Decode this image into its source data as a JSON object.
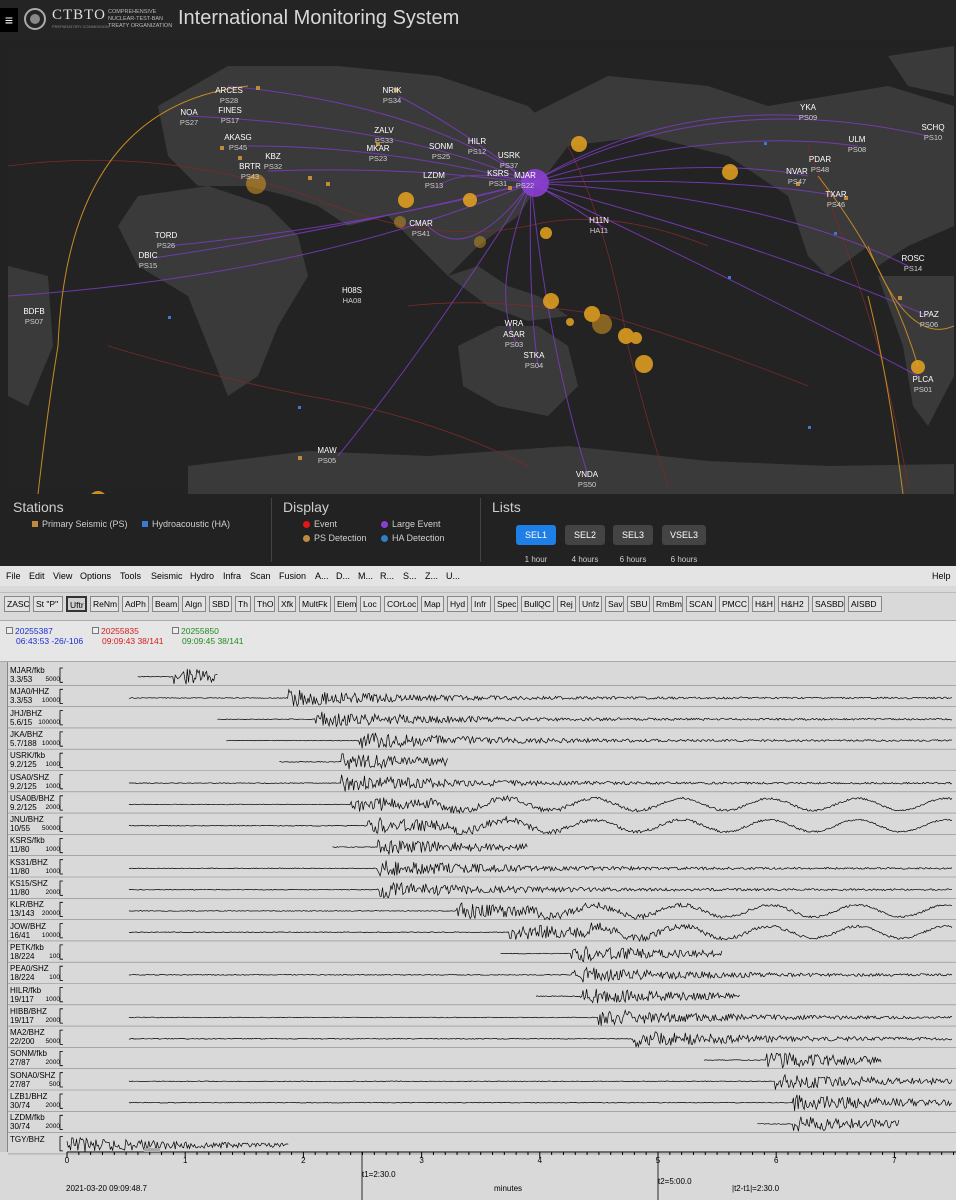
{
  "header": {
    "menu_icon": "hamburger-icon",
    "logo_name": "CTBTO",
    "logo_sub": "PREPARATORY COMMISSION",
    "logo_org": "COMPREHENSIVE NUCLEAR-TEST-BAN TREATY ORGANIZATION",
    "title": "International Monitoring System"
  },
  "map": {
    "stations": [
      {
        "name": "ARCES",
        "code": "PS28"
      },
      {
        "name": "NOA",
        "code": "PS27"
      },
      {
        "name": "FINES",
        "code": "PS17"
      },
      {
        "name": "NRIK",
        "code": "PS34"
      },
      {
        "name": "YKA",
        "code": "PS09"
      },
      {
        "name": "SCHQ",
        "code": "PS10"
      },
      {
        "name": "ULM",
        "code": "PS08"
      },
      {
        "name": "AKASG",
        "code": "PS45"
      },
      {
        "name": "ZALV",
        "code": "PS33"
      },
      {
        "name": "MKAR",
        "code": "PS23"
      },
      {
        "name": "SONM",
        "code": "PS25"
      },
      {
        "name": "HILR",
        "code": "PS12"
      },
      {
        "name": "KBZ",
        "code": "PS32"
      },
      {
        "name": "BRTR",
        "code": "PS43"
      },
      {
        "name": "USRK",
        "code": "PS37"
      },
      {
        "name": "KSRS",
        "code": "PS31"
      },
      {
        "name": "MJAR",
        "code": "PS22"
      },
      {
        "name": "PDAR",
        "code": "PS48"
      },
      {
        "name": "NVAR",
        "code": "PS47"
      },
      {
        "name": "LZDM",
        "code": "PS13"
      },
      {
        "name": "TXAR",
        "code": "PS46"
      },
      {
        "name": "CMAR",
        "code": "PS41"
      },
      {
        "name": "H11N",
        "code": "HA11"
      },
      {
        "name": "TORD",
        "code": "PS26"
      },
      {
        "name": "DBIC",
        "code": "PS15"
      },
      {
        "name": "ROSC",
        "code": "PS14"
      },
      {
        "name": "H08S",
        "code": "HA08"
      },
      {
        "name": "BDFB",
        "code": "PS07"
      },
      {
        "name": "LPAZ",
        "code": "PS06"
      },
      {
        "name": "WRA",
        "code": ""
      },
      {
        "name": "ASAR",
        "code": "PS03"
      },
      {
        "name": "STKA",
        "code": "PS04"
      },
      {
        "name": "PLCA",
        "code": "PS01"
      },
      {
        "name": "MAW",
        "code": "PS05"
      },
      {
        "name": "VNDA",
        "code": "PS50"
      }
    ]
  },
  "legend": {
    "stations_title": "Stations",
    "primary_seismic": "Primary Seismic (PS)",
    "hydroacoustic": "Hydroacoustic (HA)",
    "display_title": "Display",
    "event": "Event",
    "large_event": "Large Event",
    "ps_detection": "PS Detection",
    "ha_detection": "HA Detection",
    "lists_title": "Lists",
    "lists": [
      {
        "label": "SEL1",
        "duration": "1 hour"
      },
      {
        "label": "SEL2",
        "duration": "4 hours"
      },
      {
        "label": "SEL3",
        "duration": "6 hours"
      },
      {
        "label": "VSEL3",
        "duration": "6 hours"
      }
    ],
    "colors": {
      "primary": "#c08a3e",
      "hydro": "#3a7ad0",
      "event": "#e41616",
      "large_event": "#8b3fd1",
      "ps_det": "#c08a3e",
      "ha_det": "#2f7fc1",
      "active": "#1e7fe6"
    }
  },
  "menubar": {
    "items": [
      "File",
      "Edit",
      "View",
      "Options",
      "Tools",
      "Seismic",
      "Hydro",
      "Infra",
      "Scan",
      "Fusion",
      "A...",
      "D...",
      "M...",
      "R...",
      "S...",
      "Z...",
      "U..."
    ],
    "help": "Help"
  },
  "toolbar": {
    "buttons": [
      "ZASC",
      "St \"P\"",
      "Uftr",
      "ReNm",
      "AdPh",
      "Beam",
      "Algn",
      "SBD",
      "Th",
      "ThO",
      "Xfk",
      "MultFk",
      "Elem",
      "Loc",
      "COrLoc",
      "Map",
      "Hyd",
      "Infr",
      "Spec",
      "BullQC",
      "Rej",
      "Unfz",
      "Sav",
      "SBU",
      "RmBm",
      "SCAN",
      "PMCC",
      "H&H",
      "H&H2",
      "SASBD",
      "AISBD"
    ]
  },
  "events": [
    {
      "id": "20255387",
      "info": "06:43:53 -26/-106",
      "color": "#1a2bd6"
    },
    {
      "id": "20255835",
      "info": "09:09:43 38/141",
      "color": "#d61a1a"
    },
    {
      "id": "20255850",
      "info": "09:09:45 38/141",
      "color": "#1f8a1f"
    }
  ],
  "traces": [
    {
      "name": "MJAR/fkb",
      "dist": "3.3/53",
      "amp": "5000",
      "start": 0.08,
      "end": 0.17,
      "onset": 0.12
    },
    {
      "name": "MJA0/HHZ",
      "dist": "3.3/53",
      "amp": "10000",
      "start": 0.07,
      "end": 1.0,
      "onset": 0.25
    },
    {
      "name": "JHJ/BHZ",
      "dist": "5.6/15",
      "amp": "100000",
      "start": 0.17,
      "end": 1.0,
      "onset": 0.28
    },
    {
      "name": "JKA/BHZ",
      "dist": "5.7/188",
      "amp": "10000",
      "start": 0.18,
      "end": 1.0,
      "onset": 0.33
    },
    {
      "name": "USRK/fkb",
      "dist": "9.2/125",
      "amp": "1000",
      "start": 0.24,
      "end": 0.43,
      "onset": 0.31
    },
    {
      "name": "USA0/SHZ",
      "dist": "9.2/125",
      "amp": "1000",
      "start": 0.07,
      "end": 1.0,
      "onset": 0.31
    },
    {
      "name": "USA0B/BHZ",
      "dist": "9.2/125",
      "amp": "2000",
      "start": 0.07,
      "end": 1.0,
      "onset": 0.32
    },
    {
      "name": "JNU/BHZ",
      "dist": "10/55",
      "amp": "50000",
      "start": 0.07,
      "end": 1.0,
      "onset": 0.34
    },
    {
      "name": "KSRS/fkb",
      "dist": "11/80",
      "amp": "1000",
      "start": 0.3,
      "end": 0.52,
      "onset": 0.35
    },
    {
      "name": "KS31/BHZ",
      "dist": "11/80",
      "amp": "1000",
      "start": 0.07,
      "end": 1.0,
      "onset": 0.35
    },
    {
      "name": "KS15/SHZ",
      "dist": "11/80",
      "amp": "2000",
      "start": 0.07,
      "end": 1.0,
      "onset": 0.35
    },
    {
      "name": "KLR/BHZ",
      "dist": "13/143",
      "amp": "20000",
      "start": 0.07,
      "end": 1.0,
      "onset": 0.44
    },
    {
      "name": "JOW/BHZ",
      "dist": "16/41",
      "amp": "10000",
      "start": 0.07,
      "end": 1.0,
      "onset": 0.5
    },
    {
      "name": "PETK/fkb",
      "dist": "18/224",
      "amp": "100",
      "start": 0.49,
      "end": 0.74,
      "onset": 0.57
    },
    {
      "name": "PEA0/SHZ",
      "dist": "18/224",
      "amp": "100",
      "start": 0.07,
      "end": 1.0,
      "onset": 0.57
    },
    {
      "name": "HILR/fkb",
      "dist": "19/117",
      "amp": "1000",
      "start": 0.53,
      "end": 0.76,
      "onset": 0.58
    },
    {
      "name": "HIBB/BHZ",
      "dist": "19/117",
      "amp": "2000",
      "start": 0.07,
      "end": 1.0,
      "onset": 0.6
    },
    {
      "name": "MA2/BHZ",
      "dist": "22/200",
      "amp": "5000",
      "start": 0.07,
      "end": 1.0,
      "onset": 0.64
    },
    {
      "name": "SONM/fkb",
      "dist": "27/87",
      "amp": "2000",
      "start": 0.72,
      "end": 0.92,
      "onset": 0.79
    },
    {
      "name": "SONA0/SHZ",
      "dist": "27/87",
      "amp": "500",
      "start": 0.07,
      "end": 1.0,
      "onset": 0.8
    },
    {
      "name": "LZB1/BHZ",
      "dist": "30/74",
      "amp": "2000",
      "start": 0.07,
      "end": 1.0,
      "onset": 0.82
    },
    {
      "name": "LZDM/fkb",
      "dist": "30/74",
      "amp": "2000",
      "start": 0.78,
      "end": 0.94,
      "onset": 0.82
    },
    {
      "name": "TGY/BHZ",
      "dist": "",
      "amp": "",
      "start": 0.0,
      "end": 0.25,
      "onset": 0.0
    }
  ],
  "axis": {
    "ticks": [
      "0",
      "1",
      "2",
      "3",
      "4",
      "5",
      "6",
      "7"
    ],
    "start_time": "2021-03-20 09:09:48.7",
    "t1": "t1=2:30.0",
    "unit": "minutes",
    "t2": "t2=5:00.0",
    "dt": "|t2-t1|=2:30.0"
  }
}
